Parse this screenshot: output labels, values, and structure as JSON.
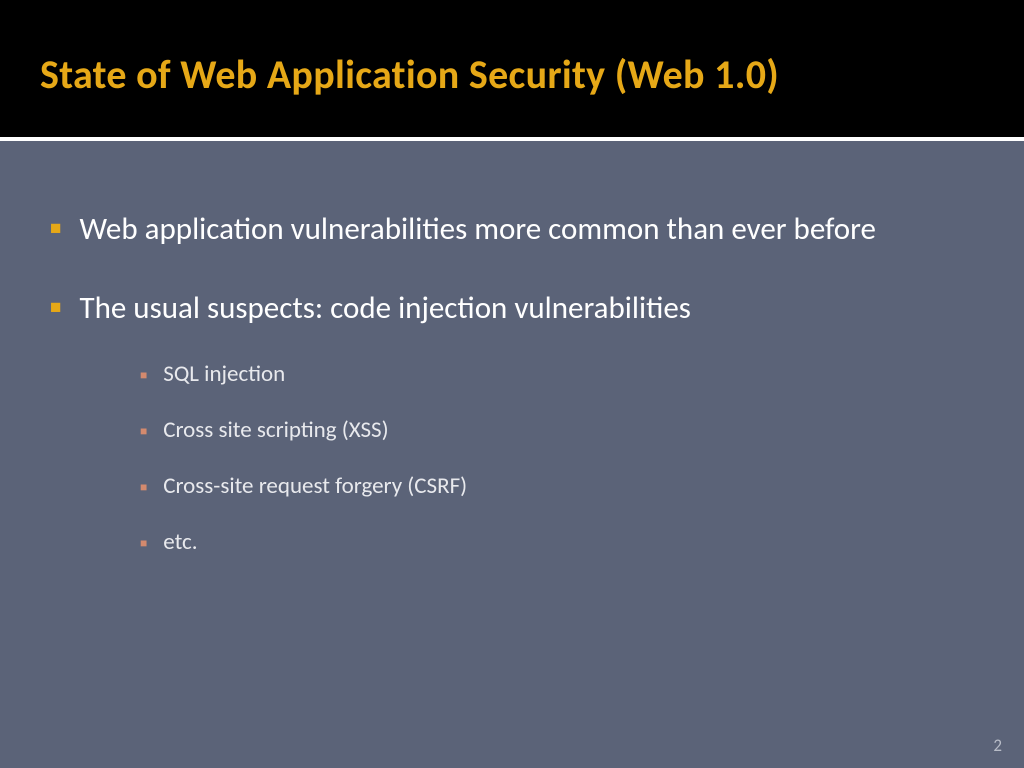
{
  "slide": {
    "title": "State of Web Application Security (Web 1.0)",
    "bullets": [
      {
        "text": "Web application vulnerabilities more common than ever before",
        "sub": []
      },
      {
        "text": "The usual suspects: code injection vulnerabilities",
        "sub": [
          "SQL injection",
          "Cross site scripting (XSS)",
          "Cross-site request forgery (CSRF)",
          "etc."
        ]
      }
    ],
    "page_number": "2"
  }
}
